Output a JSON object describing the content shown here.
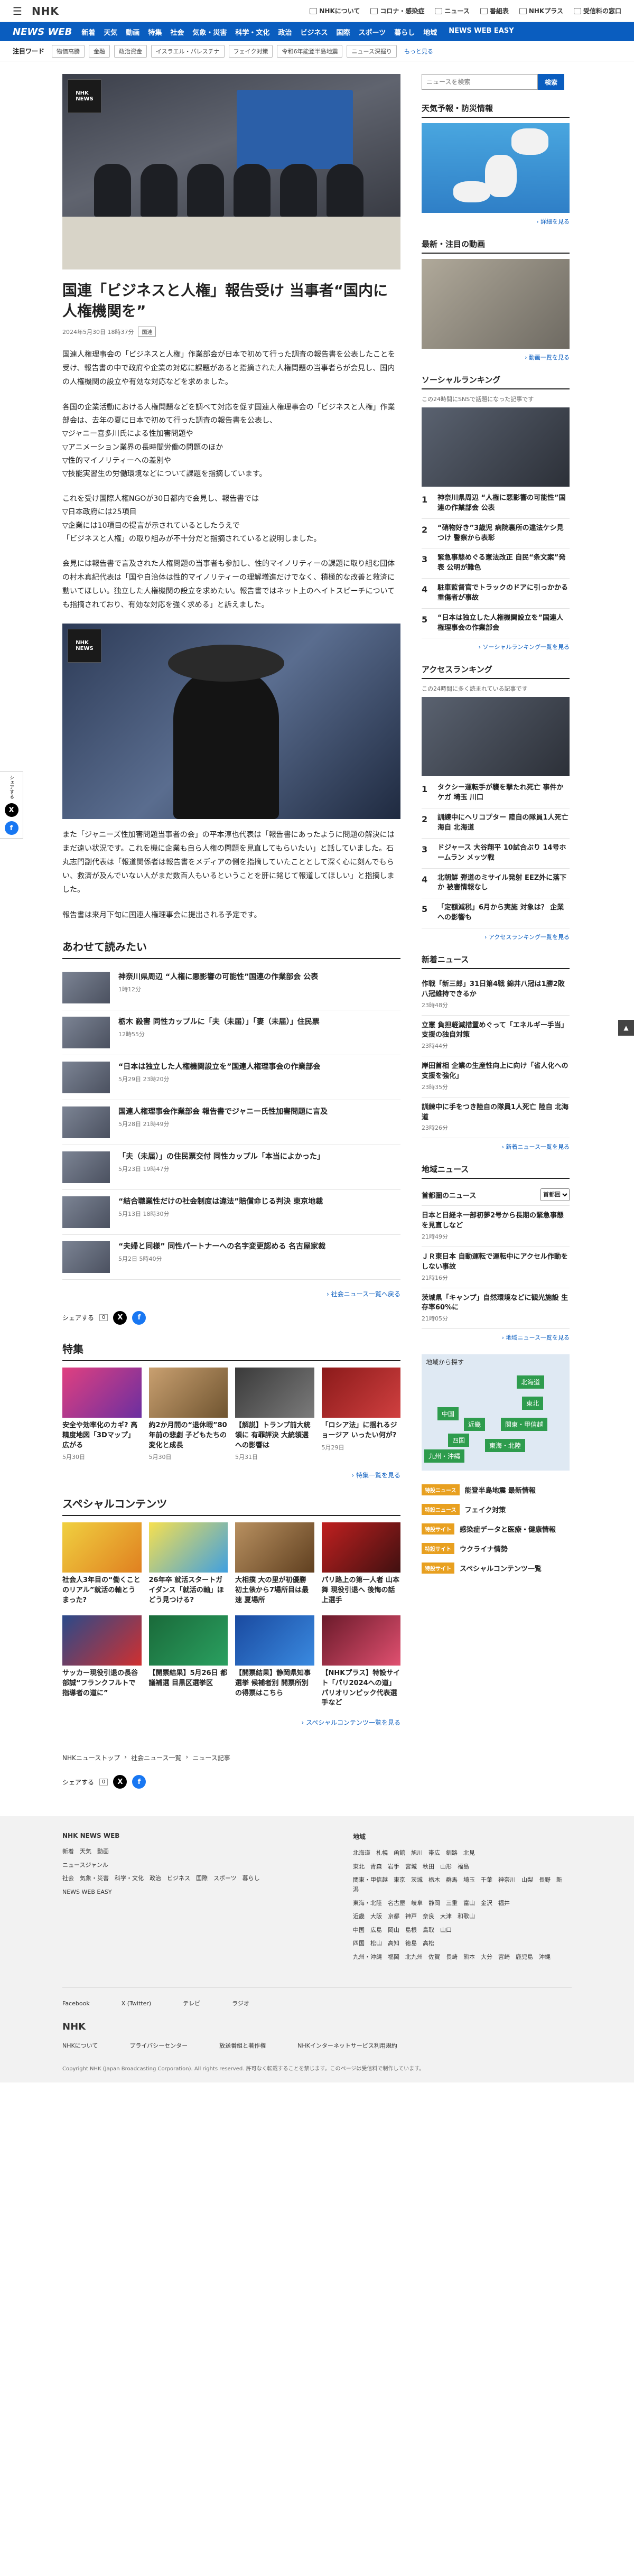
{
  "header": {
    "logo": "NHK",
    "links": [
      "NHKについて",
      "コロナ・感染症",
      "ニュース",
      "番組表",
      "NHKプラス",
      "受信料の窓口"
    ]
  },
  "nav": {
    "brand": "NEWS WEB",
    "items": [
      "新着",
      "天気",
      "動画",
      "特集",
      "社会",
      "気象・災害",
      "科学・文化",
      "政治",
      "ビジネス",
      "国際",
      "スポーツ",
      "暮らし",
      "地域"
    ],
    "easy": "NEWS WEB EASY"
  },
  "keywords": {
    "label": "注目ワード",
    "items": [
      "物価高騰",
      "金融",
      "政治資金",
      "イスラエル・パレスチナ",
      "フェイク対策",
      "令和6年能登半島地震",
      "ニュース深掘り"
    ],
    "more": "もっと見る"
  },
  "article": {
    "title": "国連「ビジネスと人権」報告受け 当事者“国内に人権機関を”",
    "date": "2024年5月30日 18時37分",
    "tag": "国連",
    "paragraphs": [
      "国連人権理事会の「ビジネスと人権」作業部会が日本で初めて行った調査の報告書を公表したことを受け、報告書の中で政府や企業の対応に課題があると指摘された人権問題の当事者らが会見し、国内の人権機関の設立や有効な対応などを求めました。",
      "各国の企業活動における人権問題などを調べて対応を促す国連人権理事会の「ビジネスと人権」作業部会は、去年の夏に日本で初めて行った調査の報告書を公表し、\n▽ジャニー喜多川氏による性加害問題や\n▽アニメーション業界の長時間労働の問題のほか\n▽性的マイノリティーへの差別や\n▽技能実習生の労働環境などについて課題を指摘しています。",
      "これを受け国際人権NGOが30日都内で会見し、報告書では\n▽日本政府には25項目\n▽企業には10項目の提言が示されているとしたうえで\n「ビジネスと人権」の取り組みが不十分だと指摘されていると説明しました。",
      "会見には報告書で言及された人権問題の当事者も参加し、性的マイノリティーの課題に取り組む団体の村木真紀代表は「国や自治体は性的マイノリティーの理解増進だけでなく、積極的な改善と救済に動いてほしい。独立した人権機関の設立を求めたい。報告書ではネット上のヘイトスピーチについても指摘されており、有効な対応を強く求める」と訴えました。",
      "また「ジャニーズ性加害問題当事者の会」の平本淳也代表は「報告書にあったように問題の解決にはまだ遠い状況です。これを機に企業も自ら人権の問題を見直してもらいたい」と話していました。石丸志門副代表は「報道関係者は報告書をメディアの側を指摘していたこととして深く心に刻んでもらい、救済が及んでいない人がまだ数百人もいるということを肝に銘じて報道してほしい」と指摘しました。",
      "報告書は来月下旬に国連人権理事会に提出される予定です。"
    ]
  },
  "related": {
    "heading": "あわせて読みたい",
    "items": [
      {
        "title": "神奈川県周辺 “人権に悪影響の可能性”国連の作業部会 公表",
        "date": "1時12分"
      },
      {
        "title": "栃木 殺害 同性カップルに「夫（未届）」「妻（未届）」住民票",
        "date": "12時55分"
      },
      {
        "title": "“日本は独立した人権機関設立を”国連人権理事会の作業部会",
        "date": "5月29日 23時20分"
      },
      {
        "title": "国連人権理事会作業部会 報告書でジャニー氏性加害問題に言及",
        "date": "5月28日 21時49分"
      },
      {
        "title": "「夫（未届）」の住民票交付 同性カップル「本当によかった」",
        "date": "5月23日 19時47分"
      },
      {
        "title": "“結合職業性だけの社会制度は違法”賠償命じる判決 東京地裁",
        "date": "5月13日 18時30分"
      },
      {
        "title": "“夫婦と同様” 同性パートナーへの名字変更認める 名古屋家裁",
        "date": "5月2日 5時40分"
      }
    ],
    "more": "社会ニュース一覧へ戻る"
  },
  "share": {
    "label": "シェアする",
    "count": "0"
  },
  "features": {
    "heading": "特集",
    "items": [
      {
        "title": "安全や効率化のカギ? 高精度地図「3Dマップ」広がる",
        "date": "5月30日"
      },
      {
        "title": "約2か月間の“退休暇”80年前の悲劇 子どもたちの変化と成長",
        "date": "5月30日"
      },
      {
        "title": "【解説】トランプ前大統領に 有罪評決 大統領選への影響は",
        "date": "5月31日"
      },
      {
        "title": "「ロシア法」に揺れるジョージア いったい何が?",
        "date": "5月29日"
      }
    ],
    "more": "特集一覧を見る"
  },
  "special": {
    "heading": "スペシャルコンテンツ",
    "items": [
      {
        "title": "社会人3年目の“働くことのリアル”就活の軸とうまった?"
      },
      {
        "title": "26年卒 就活スタートガイダンス「就活の軸」ほどう見つける?"
      },
      {
        "title": "大相撲 大の里が初優勝 初土俵から7場所目は最速 夏場所"
      },
      {
        "title": "パリ路上の第一人者 山本舞 現役引退へ 後悔の話上選手"
      },
      {
        "title": "サッカー現役引退の長谷部誠“フランクフルトで指導者の道に”"
      },
      {
        "title": "【開票結果】5月26日 都議補選 目黒区選挙区"
      },
      {
        "title": "【開票結果】静岡県知事選挙 候補者別 開票所別の得票はこちら"
      },
      {
        "title": "【NHKプラス】特設サイト「パリ2024への道」パリオリンピック代表選手など"
      }
    ],
    "more": "スペシャルコンテンツ一覧を見る"
  },
  "breadcrumb": [
    "NHKニューストップ",
    "社会ニュース一覧",
    "ニュース記事"
  ],
  "sidebar": {
    "search_placeholder": "ニュースを検索",
    "search_btn": "検索",
    "weather": {
      "title": "天気予報・防災情報",
      "more": "詳細を見る"
    },
    "latest": {
      "title": "最新・注目の動画",
      "more": "動画一覧を見る"
    },
    "social": {
      "title": "ソーシャルランキング",
      "note": "この24時間にSNSで話題になった記事です",
      "items": [
        "神奈川県周辺 “人権に悪影響の可能性”国連の作業部会 公表",
        "“硝物好き”3歳児 病院裏所の違法ケシ見つけ 警察から表彰",
        "緊急事態めぐる憲法改正 自民“条文案”発表 公明が難色",
        "駐車監督官でトラックのドアに引っかかる重傷者が事故",
        "“日本は独立した人権機関設立を”国連人権理事会の作業部会"
      ],
      "more": "ソーシャルランキング一覧を見る"
    },
    "access": {
      "title": "アクセスランキング",
      "note": "この24時間に多く読まれている記事です",
      "items": [
        "タクシー運転手が襲を撃たれ死亡 事件かケガ 埼玉 川口",
        "訓練中にヘリコプター 陸自の隊員1人死亡 海自 北海道",
        "ドジャース 大谷翔平 10試合ぶり 14号ホームラン メッツ戦",
        "北朝鮮 弾道のミサイル発射 EEZ外に落下か 被害情報なし",
        "「定額減税」6月から実施 対象は？ 企業への影響も"
      ],
      "more": "アクセスランキング一覧を見る"
    },
    "newest": {
      "title": "新着ニュース",
      "items": [
        {
          "title": "作戦「新三郎」31日第4戦 錦井八冠は1勝2敗 八冠維持できるか",
          "date": "23時48分"
        },
        {
          "title": "立憲 負担軽減措置めぐって「エネルギー手当」支援の独自対策",
          "date": "23時44分"
        },
        {
          "title": "岸田首相 企業の生産性向上に向け「省人化への支援を強化」",
          "date": "23時35分"
        },
        {
          "title": "訓練中に手をつき陸自の隊員1人死亡 陸自 北海道",
          "date": "23時26分"
        }
      ],
      "more": "新着ニュース一覧を見る"
    },
    "local": {
      "title": "地域ニュース",
      "region_label": "首都圏のニュース",
      "select": "首都圏",
      "items": [
        {
          "title": "日本と日経ネ一部初夢2号から長期の緊急事態を見直しなど",
          "date": "21時49分"
        },
        {
          "title": "ＪＲ東日本 自動運転で運転中にアクセル作動をしない事故",
          "date": "21時16分"
        },
        {
          "title": "茨城県「キャンプ」自然環境などに観光施設 生存率60%に",
          "date": "21時05分"
        }
      ],
      "more": "地域ニュース一覧を見る"
    },
    "regions": {
      "title": "地域から探す",
      "list": [
        "北海道",
        "東北",
        "関東・甲信越",
        "東海・北陸",
        "近畿",
        "中国",
        "四国",
        "九州・沖縄"
      ]
    },
    "specials": [
      {
        "badge": "特設ニュース",
        "title": "能登半島地震 最新情報"
      },
      {
        "badge": "特設ニュース",
        "title": "フェイク対策"
      },
      {
        "badge": "特設サイト",
        "title": "感染症データと医療・健康情報"
      },
      {
        "badge": "特設サイト",
        "title": "ウクライナ情勢"
      },
      {
        "badge": "特設サイト",
        "title": "スペシャルコンテンツ一覧"
      }
    ]
  },
  "footer": {
    "brand": "NHK NEWS WEB",
    "cols": [
      {
        "title": "",
        "items": [
          "新着　天気　動画",
          "ニュースジャンル",
          "社会　気象・災害　科学・文化　政治　ビジネス　国際　スポーツ　暮らし",
          "NEWS WEB EASY"
        ]
      },
      {
        "title": "地域",
        "items": [
          "北海道　札幌　函館　旭川　帯広　釧路　北見",
          "東北　青森　岩手　宮城　秋田　山形　福島",
          "関東・甲信越　東京　茨城　栃木　群馬　埼玉　千葉　神奈川　山梨　長野　新潟",
          "東海・北陸　名古屋　岐阜　静岡　三重　富山　金沢　福井",
          "近畿　大阪　京都　神戸　奈良　大津　和歌山",
          "中国　広島　岡山　島根　鳥取　山口",
          "四国　松山　高知　徳島　高松",
          "九州・沖縄　福岡　北九州　佐賀　長崎　熊本　大分　宮崎　鹿児島　沖縄"
        ]
      }
    ],
    "social": [
      "Facebook",
      "X (Twitter)",
      "テレビ",
      "ラジオ"
    ],
    "links": [
      "NHKについて",
      "プライバシーセンター",
      "放送番組と著作権",
      "NHKインターネットサービス利用規約"
    ],
    "logo": "NHK",
    "copyright": "Copyright NHK (Japan Broadcasting Corporation). All rights reserved. 許可なく転載することを禁じます。このページは受信料で制作しています。"
  }
}
